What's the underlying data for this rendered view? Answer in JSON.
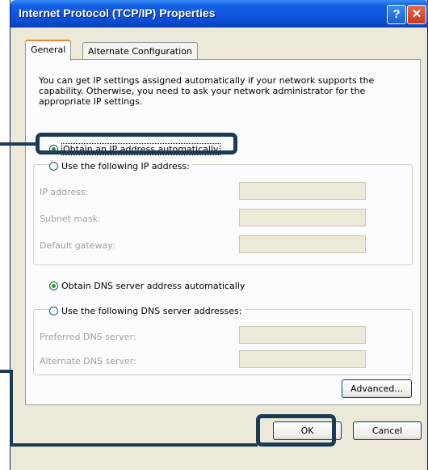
{
  "window": {
    "title": "Internet Protocol (TCP/IP) Properties",
    "help_button": "?",
    "close_button": "✕"
  },
  "tabs": [
    {
      "label": "General",
      "active": true
    },
    {
      "label": "Alternate Configuration",
      "active": false
    }
  ],
  "description": "You can get IP settings assigned automatically if your network supports the capability. Otherwise, you need to ask your network administrator for the appropriate IP settings.",
  "ip_options": {
    "auto_label": "Obtain an IP address automatically",
    "auto_selected": true,
    "manual_label": "Use the following IP address:",
    "manual_selected": false,
    "fields": [
      {
        "label": "IP address:",
        "value": ""
      },
      {
        "label": "Subnet mask:",
        "value": ""
      },
      {
        "label": "Default gateway:",
        "value": ""
      }
    ]
  },
  "dns_options": {
    "auto_label": "Obtain DNS server address automatically",
    "auto_selected": true,
    "manual_label": "Use the following DNS server addresses:",
    "manual_selected": false,
    "fields": [
      {
        "label": "Preferred DNS server:",
        "value": ""
      },
      {
        "label": "Alternate DNS server:",
        "value": ""
      }
    ]
  },
  "buttons": {
    "advanced": "Advanced...",
    "ok": "OK",
    "cancel": "Cancel"
  },
  "colors": {
    "title_bar": "#0a50d8",
    "highlight": "#1b3a55",
    "radio_dot": "#21a121"
  }
}
